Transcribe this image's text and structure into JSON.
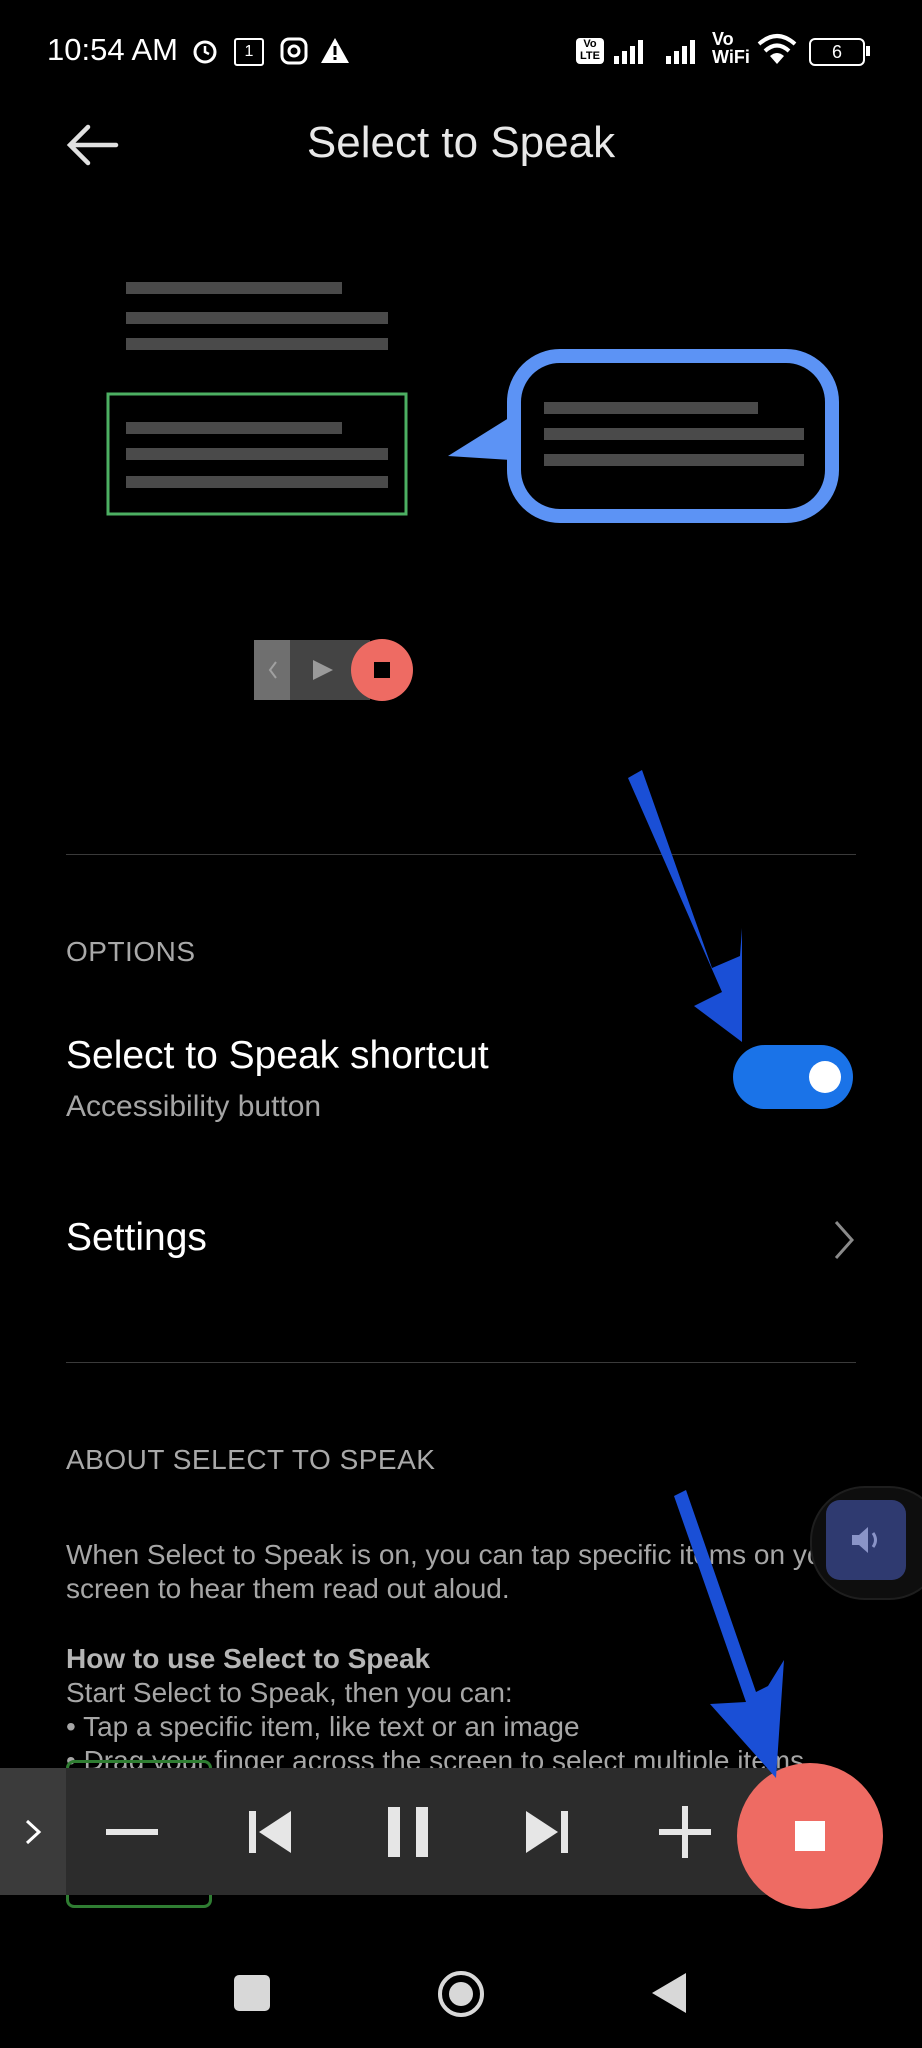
{
  "status_bar": {
    "time": "10:54 AM",
    "notif_badge": "1",
    "battery": "6",
    "wifi_label_top": "Vo",
    "wifi_label_bottom": "WiFi",
    "volte_label": "Vo LTE"
  },
  "header": {
    "title": "Select to Speak"
  },
  "options": {
    "section_label": "OPTIONS",
    "shortcut_title": "Select to Speak shortcut",
    "shortcut_subtitle": "Accessibility button",
    "shortcut_enabled": true,
    "settings_label": "Settings"
  },
  "about": {
    "section_label": "ABOUT SELECT TO SPEAK",
    "paragraph": "When Select to Speak is on, you can tap specific items on your screen to hear them read out aloud.",
    "howto_heading": "How to use Select to Speak",
    "howto_intro": "Start Select to Speak, then you can:",
    "bullet_1": "• Tap a specific item, like text or an image",
    "bullet_2": "• Drag your finger across the screen to select multiple items"
  },
  "colors": {
    "accent": "#1a73e8",
    "stop_button": "#ee6b63",
    "annotation_arrow": "#1a4fd6",
    "illustration_green": "#4caf62",
    "illustration_blue": "#5c93f5"
  },
  "icons": {
    "back": "back-arrow-icon",
    "settings_chevron": "chevron-right-icon",
    "player_expand": "chevron-right-icon",
    "minus": "minus-icon",
    "previous": "skip-previous-icon",
    "pause": "pause-icon",
    "next": "skip-next-icon",
    "plus": "plus-icon",
    "stop": "stop-icon"
  }
}
